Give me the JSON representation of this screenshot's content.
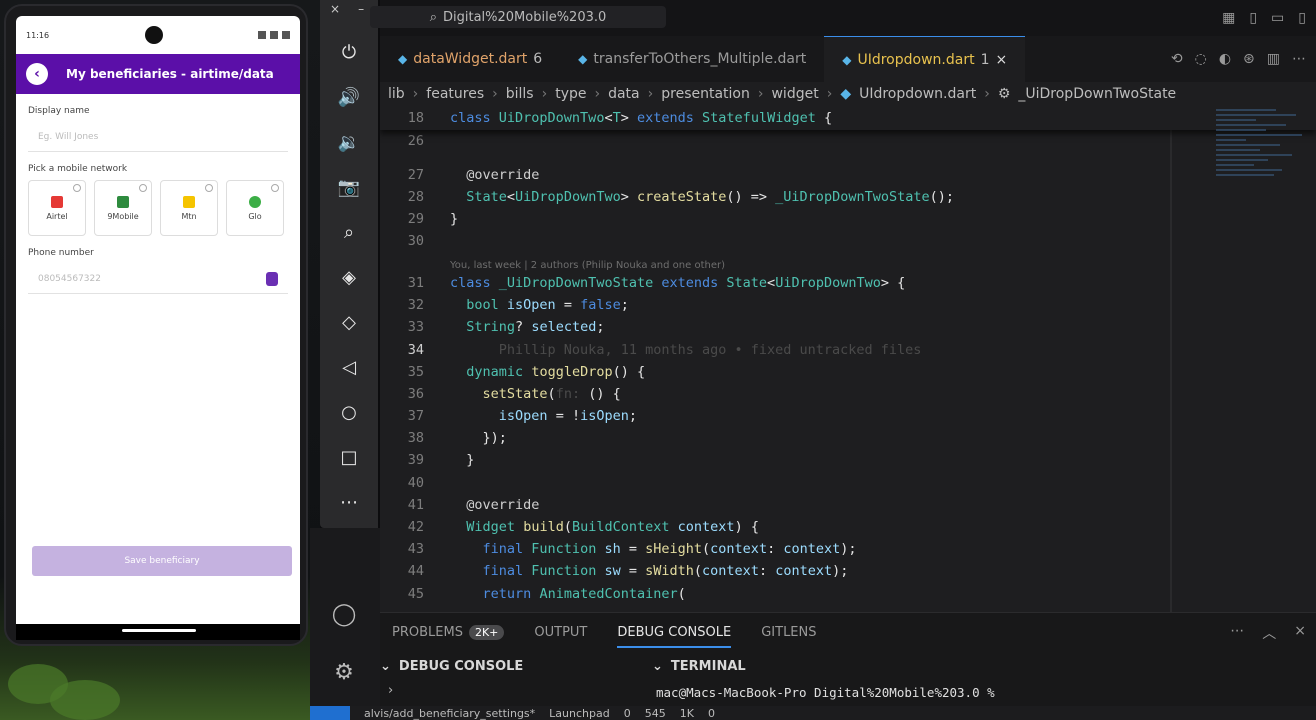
{
  "phone": {
    "status_time": "11:16",
    "app_title": "My beneficiaries - airtime/data",
    "display_name_label": "Display name",
    "display_name_placeholder": "Eg. Will Jones",
    "network_label": "Pick a mobile network",
    "networks": [
      "Airtel",
      "9Mobile",
      "Mtn",
      "Glo"
    ],
    "phone_label": "Phone number",
    "phone_placeholder": "08054567322",
    "save_label": "Save beneficiary"
  },
  "editor": {
    "search": "Digital%20Mobile%203.0",
    "tabs": [
      {
        "name": "dataWidget.dart",
        "count": "6"
      },
      {
        "name": "transferToOthers_Multiple.dart",
        "count": ""
      },
      {
        "name": "UIdropdown.dart",
        "count": "1"
      }
    ],
    "breadcrumbs": [
      "lib",
      "features",
      "bills",
      "type",
      "data",
      "presentation",
      "widget",
      "UIdropdown.dart",
      "_UiDropDownTwoState"
    ],
    "blame": "You, last week | 2 authors (Philip Nouka and one other)",
    "ghost_blame": "Phillip Nouka, 11 months ago • fixed untracked files"
  },
  "panel": {
    "tabs": [
      "PROBLEMS",
      "OUTPUT",
      "DEBUG CONSOLE",
      "GITLENS"
    ],
    "problems_count": "2K+",
    "debug_console_label": "DEBUG CONSOLE",
    "terminal_label": "TERMINAL",
    "terminal_line": "mac@Macs-MacBook-Pro Digital%20Mobile%203.0 %"
  },
  "statusbar": {
    "branch": "alvis/add_beneficiary_settings*",
    "launchpad": "Launchpad",
    "errors": "0",
    "warnings": "545",
    "info": "1K",
    "ports": "0"
  },
  "colors": {
    "app_purple": "#5b0fa8",
    "tab_active_text": "#e8c24e",
    "keyword": "#4d8ce0",
    "type": "#4fc1b0",
    "function": "#e4dda0"
  }
}
